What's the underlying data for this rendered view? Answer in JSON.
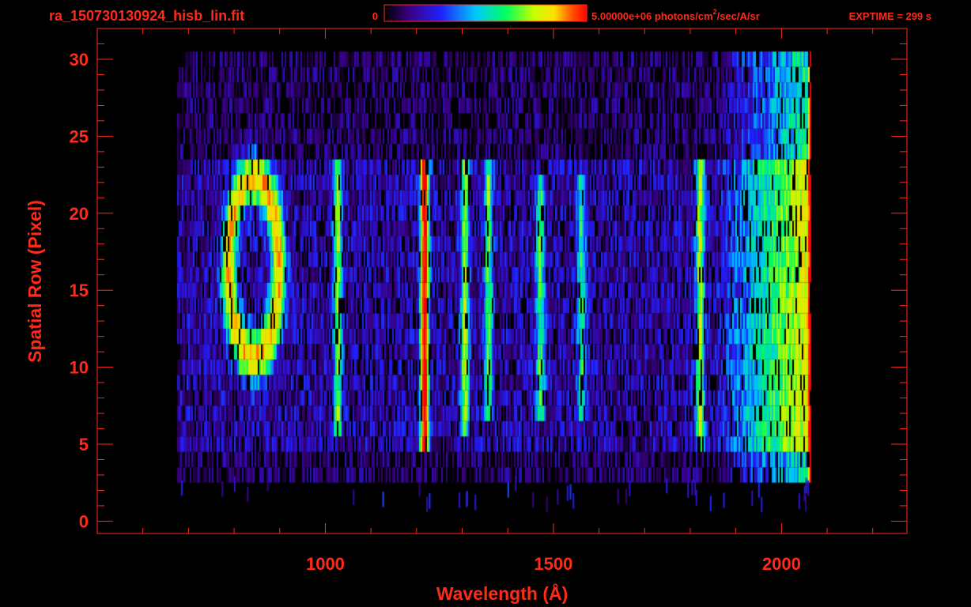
{
  "header": {
    "filename": "ra_150730130924_hisb_lin.fit",
    "colorbar_min": "0",
    "colorbar_max_value": "5.00000e+06 photons/cm",
    "colorbar_max_sup": "2",
    "colorbar_max_unit": "/sec/A/sr",
    "exptime": "EXPTIME = 299 s"
  },
  "colors": {
    "accent": "#ff2a1a",
    "background": "#000000",
    "colormap": [
      "#000000",
      "#3a0080",
      "#2020ff",
      "#00c8ff",
      "#00ff60",
      "#c8ff00",
      "#ffe000",
      "#ff5000",
      "#ff0000"
    ]
  },
  "chart_data": {
    "type": "heatmap",
    "title": "",
    "xlabel": "Wavelength (Å)",
    "ylabel": "Spatial Row (Pixel)",
    "xlim": [
      500,
      2275
    ],
    "ylim": [
      -0.8,
      32
    ],
    "xticks": [
      1000,
      1500,
      2000
    ],
    "yticks": [
      0,
      5,
      10,
      15,
      20,
      25,
      30
    ],
    "xminor_step": 100,
    "yminor_step": 1,
    "grid": false,
    "legend": "colorbar-top",
    "rows_bright": [
      5,
      23
    ],
    "rows_faint": [
      3,
      30
    ],
    "wavelength_range": [
      675,
      2065
    ],
    "features": [
      {
        "kind": "emission_line",
        "wavelength": 1216,
        "rows": [
          5,
          23
        ],
        "intensity": 0.88
      },
      {
        "kind": "emission_line",
        "wavelength": 1026,
        "rows": [
          6,
          23
        ],
        "intensity": 0.42
      },
      {
        "kind": "emission_line",
        "wavelength": 1304,
        "rows": [
          6,
          23
        ],
        "intensity": 0.45
      },
      {
        "kind": "emission_line",
        "wavelength": 1356,
        "rows": [
          7,
          23
        ],
        "intensity": 0.38
      },
      {
        "kind": "emission_line",
        "wavelength": 1470,
        "rows": [
          7,
          22
        ],
        "intensity": 0.36
      },
      {
        "kind": "emission_line",
        "wavelength": 1560,
        "rows": [
          7,
          22
        ],
        "intensity": 0.32
      },
      {
        "kind": "emission_line",
        "wavelength": 1820,
        "rows": [
          5,
          23
        ],
        "intensity": 0.48
      },
      {
        "kind": "ring",
        "center_wavelength": 842,
        "center_row": 16.5,
        "radius_wavelength": 55,
        "radius_row": 5.8,
        "intensity": 0.62
      },
      {
        "kind": "continuum_rise",
        "wavelength_range": [
          1850,
          2065
        ],
        "intensity": 0.55
      },
      {
        "kind": "edge_line",
        "wavelength": 2062,
        "rows": [
          3,
          30
        ],
        "intensity": 0.95
      }
    ]
  }
}
